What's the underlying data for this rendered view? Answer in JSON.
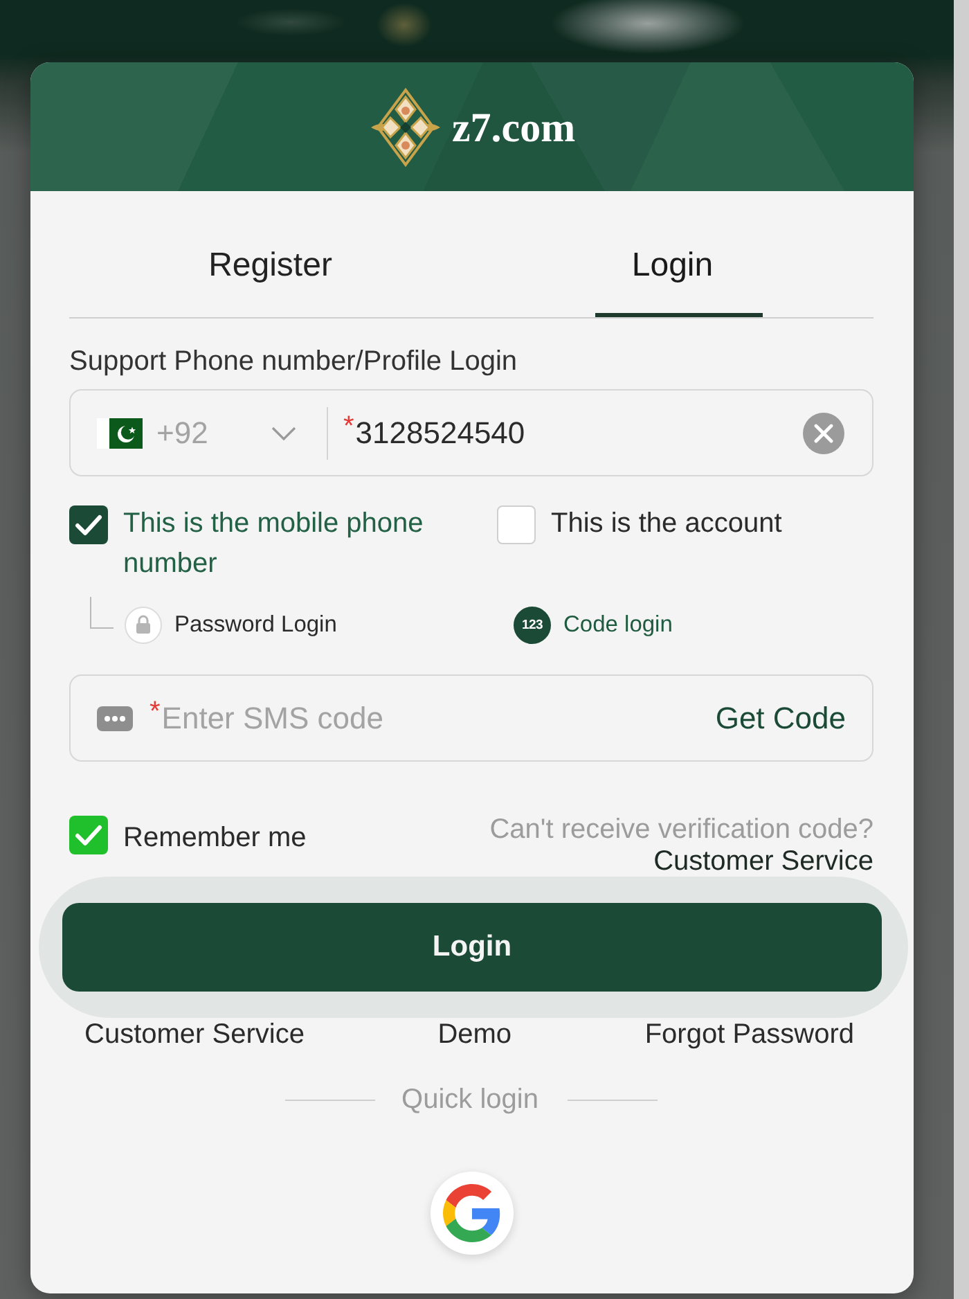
{
  "header": {
    "logo_text": "z7.com"
  },
  "tabs": [
    {
      "label": "Register",
      "selected": false
    },
    {
      "label": "Login",
      "selected": true
    }
  ],
  "phone_field": {
    "label": "Support Phone number/Profile Login",
    "country_code": "+92",
    "required_mark": "*",
    "value": "3128524540"
  },
  "account_type": [
    {
      "label": "This is the mobile phone number",
      "checked": true
    },
    {
      "label": "This is the account",
      "checked": false
    }
  ],
  "login_methods": [
    {
      "kind": "password",
      "label": "Password Login",
      "selected": false
    },
    {
      "kind": "code",
      "label": "Code login",
      "icon_text": "123",
      "selected": true
    }
  ],
  "sms_field": {
    "required_mark": "*",
    "placeholder": "Enter SMS code",
    "action": "Get Code"
  },
  "remember_me": {
    "label": "Remember me",
    "checked": true
  },
  "verification_help": {
    "question": "Can't receive verification code?",
    "link": "Customer Service"
  },
  "login_button": {
    "label": "Login"
  },
  "footer_links": [
    "Customer Service",
    "Demo",
    "Forgot Password"
  ],
  "quick_login": {
    "label": "Quick login"
  }
}
